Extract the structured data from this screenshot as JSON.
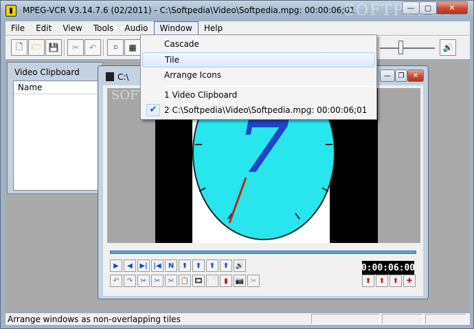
{
  "window": {
    "title": "MPEG-VCR V3.14.7.6 (02/2011) - C:\\Softpedia\\Video\\Softpedia.mpg: 00:00:06;01",
    "watermark": "SOFTPEDIA"
  },
  "menubar": {
    "items": [
      "File",
      "Edit",
      "View",
      "Tools",
      "Audio",
      "Window",
      "Help"
    ],
    "active": "Window"
  },
  "window_menu": {
    "items": [
      "Cascade",
      "Tile",
      "Arrange Icons"
    ],
    "hovered": "Tile",
    "windows": [
      "1 Video Clipboard",
      "2 C:\\Softpedia\\Video\\Softpedia.mpg: 00:00:06;01"
    ],
    "checked": "2 C:\\Softpedia\\Video\\Softpedia.mpg: 00:00:06;01"
  },
  "clipboard": {
    "title": "Video Clipboard",
    "column_header": "Name"
  },
  "video_window": {
    "title": "C:\\",
    "watermark": "SOFTPE",
    "time": "0:00:06:00",
    "frame_digit": "7",
    "position_fraction": 0.0
  },
  "statusbar": {
    "text": "Arrange windows as non-overlapping tiles"
  },
  "colors": {
    "clock_face": "#27e6ee",
    "digit": "#1e45c8",
    "hand": "#c0261d",
    "accent_blue": "#0b4fd3",
    "accent_red": "#c11b12"
  }
}
